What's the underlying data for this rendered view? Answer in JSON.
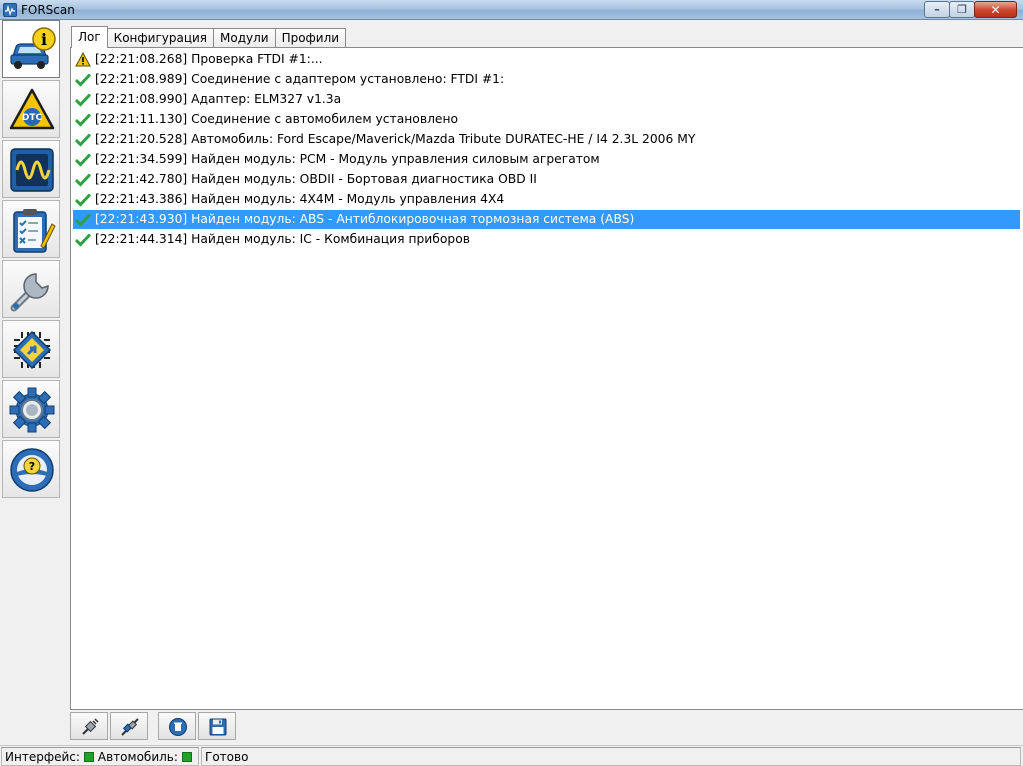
{
  "window": {
    "title": "FORScan",
    "minimize_glyph": "–",
    "restore_glyph": "❐",
    "close_glyph": "✕"
  },
  "sidebar": {
    "items": [
      {
        "name": "vehicle-info",
        "icon": "car-info-icon",
        "label": "",
        "active": true
      },
      {
        "name": "dtc",
        "icon": "dtc-warning-icon",
        "label": "DTC"
      },
      {
        "name": "oscilloscope",
        "icon": "oscilloscope-icon",
        "label": ""
      },
      {
        "name": "tests",
        "icon": "checklist-icon",
        "label": ""
      },
      {
        "name": "service",
        "icon": "wrench-icon",
        "label": ""
      },
      {
        "name": "configuration",
        "icon": "chip-icon",
        "label": ""
      },
      {
        "name": "settings",
        "icon": "gear-icon",
        "label": ""
      },
      {
        "name": "help",
        "icon": "steering-help-icon",
        "label": ""
      }
    ]
  },
  "tabs": [
    {
      "label": "Лог",
      "active": true
    },
    {
      "label": "Конфигурация"
    },
    {
      "label": "Модули"
    },
    {
      "label": "Профили"
    }
  ],
  "log": {
    "entries": [
      {
        "status": "warning",
        "text": "[22:21:08.268] Проверка FTDI #1:..."
      },
      {
        "status": "ok",
        "text": "[22:21:08.989] Соединение с адаптером установлено: FTDI #1:"
      },
      {
        "status": "ok",
        "text": "[22:21:08.990] Адаптер:  ELM327 v1.3a"
      },
      {
        "status": "ok",
        "text": "[22:21:11.130] Соединение с автомобилем установлено"
      },
      {
        "status": "ok",
        "text": "[22:21:20.528] Автомобиль: Ford Escape/Maverick/Mazda Tribute DURATEC-HE / I4 2.3L 2006 MY"
      },
      {
        "status": "ok",
        "text": "[22:21:34.599] Найден модуль:  PCM - Модуль управления силовым агрегатом"
      },
      {
        "status": "ok",
        "text": "[22:21:42.780] Найден модуль:  OBDII - Бортовая диагностика OBD II"
      },
      {
        "status": "ok",
        "text": "[22:21:43.386] Найден модуль:  4X4M - Модуль управления 4X4"
      },
      {
        "status": "ok",
        "text": "[22:21:43.930] Найден модуль:  ABS - Антиблокировочная тормозная система (ABS)",
        "selected": true
      },
      {
        "status": "ok",
        "text": "[22:21:44.314] Найден модуль:  IC - Комбинация приборов"
      }
    ]
  },
  "bottom_toolbar": [
    {
      "name": "disconnect-button",
      "icon": "plug-icon"
    },
    {
      "name": "connect-button",
      "icon": "plug-connect-icon"
    },
    {
      "name": "clear-log-button",
      "icon": "trash-icon"
    },
    {
      "name": "save-log-button",
      "icon": "floppy-icon"
    }
  ],
  "statusbar": {
    "interface_label": "Интерфейс:",
    "vehicle_label": "Автомобиль:",
    "state_text": "Готово",
    "led_color": "#22a02a"
  },
  "colors": {
    "selection": "#3399ff",
    "ok_check": "#2ea043",
    "warning": "#f2c500"
  }
}
